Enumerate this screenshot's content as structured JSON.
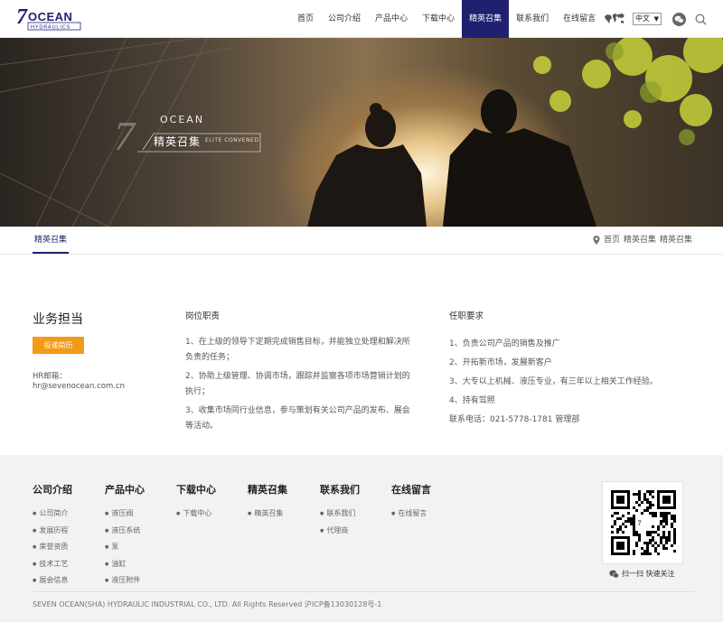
{
  "header": {
    "logo": {
      "mark": "7",
      "word": "OCEAN",
      "sub": "HYDRAULICS"
    },
    "nav": [
      "首页",
      "公司介绍",
      "产品中心",
      "下载中心",
      "精英召集",
      "联系我们",
      "在线留言"
    ],
    "nav_active_index": 4,
    "language": "中文",
    "icons": [
      "world-map-icon",
      "wechat-icon",
      "search-icon"
    ]
  },
  "banner": {
    "brand": "OCEAN",
    "title": "精英召集",
    "subtitle": "ELITE CONVENED"
  },
  "subnav": {
    "tab": "精英召集",
    "breadcrumb": [
      "首页",
      "精英召集",
      "精英召集"
    ]
  },
  "job": {
    "title": "业务担当",
    "apply_label": "投递简历",
    "hr_label": "HR邮箱：",
    "hr_email": "hr@sevenocean.com.cn",
    "duties_head": "岗位职责",
    "duties": [
      "1、在上级的领导下定期完成销售目标，并能独立处理和解决所负责的任务；",
      "2、协助上级管理、协调市场，跟踪并监察各项市场营销计划的执行；",
      "3、收集市场同行业信息，参与策划有关公司产品的发布、展会等活动。"
    ],
    "req_head": "任职要求",
    "requirements": [
      "1、负责公司产品的销售及推广",
      "2、开拓新市场，发展新客户",
      "3、大专以上机械、液压专业，有三年以上相关工作经验。",
      "4、持有驾照",
      "联系电话：021-5778-1781 管理部"
    ]
  },
  "footer": {
    "columns": [
      {
        "head": "公司介绍",
        "links": [
          "公司简介",
          "发展历程",
          "荣誉资质",
          "技术工艺",
          "展会信息"
        ]
      },
      {
        "head": "产品中心",
        "links": [
          "液压阀",
          "液压系统",
          "泵",
          "油缸",
          "液压附件"
        ]
      },
      {
        "head": "下载中心",
        "links": [
          "下载中心"
        ]
      },
      {
        "head": "精英召集",
        "links": [
          "精英召集"
        ]
      },
      {
        "head": "联系我们",
        "links": [
          "联系我们",
          "代理商"
        ]
      },
      {
        "head": "在线留言",
        "links": [
          "在线留言"
        ]
      }
    ],
    "qr_caption": "扫一扫 快速关注",
    "copyright": "SEVEN OCEAN(SHA) HYDRAULIC INDUSTRIAL CO., LTD. All Rights Reserved 沪ICP备13030128号-1"
  },
  "colors": {
    "brand_navy": "#1f2170",
    "apply_orange": "#f29a1a",
    "footer_bg": "#f2f2f2"
  }
}
